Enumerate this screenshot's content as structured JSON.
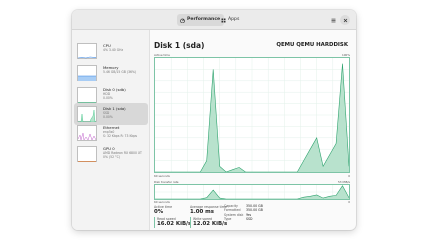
{
  "header": {
    "tabs": [
      {
        "label": "Performance",
        "icon": "performance-icon",
        "active": true
      },
      {
        "label": "Apps",
        "icon": "apps-icon",
        "active": false
      }
    ]
  },
  "sidebar": {
    "items": [
      {
        "title": "CPU",
        "sub1": "4% 3.40 GHz",
        "sub2": "",
        "color": "#3584e4",
        "selected": false
      },
      {
        "title": "Memory",
        "sub1": "5.46 GB/15 GB (36%)",
        "sub2": "",
        "color": "#3584e4",
        "selected": false
      },
      {
        "title": "Disk 0 (sdb)",
        "sub1": "HDD",
        "sub2": "0.00%",
        "color": "#2ec27e",
        "selected": false
      },
      {
        "title": "Disk 1 (sda)",
        "sub1": "SSD",
        "sub2": "0.00%",
        "color": "#2ec27e",
        "selected": true
      },
      {
        "title": "Ethernet",
        "sub1": "enp5s0",
        "sub2": "S: 32 Kbps R: 73 Kbps",
        "color": "#c061cb",
        "selected": false
      },
      {
        "title": "GPU 0",
        "sub1": "AMD Radeon RX 6800 XT",
        "sub2": "0% (52 °C)",
        "color": "#e66100",
        "selected": false
      }
    ]
  },
  "main": {
    "title": "Disk 1 (sda)",
    "device": "QEMU QEMU HARDDISK",
    "active_time_label": "Active time",
    "max_label": "100%",
    "sixty_label": "60 seconds",
    "zero_label": "0",
    "transfer_label": "Disk transfer rate",
    "transfer_max": "53 MiB/s",
    "transfer_sixty": "60 seconds",
    "transfer_zero": "0"
  },
  "stats": {
    "active_time": {
      "label": "Active time",
      "value": "0%"
    },
    "response": {
      "label": "Average response time",
      "value": "1.00 ms"
    },
    "read": {
      "label": "Read speed",
      "value": "16.02 KiB/s"
    },
    "write": {
      "label": "Write speed",
      "value": "12.02 KiB/s"
    }
  },
  "info": [
    {
      "k": "Capacity",
      "v": "350.00 GB"
    },
    {
      "k": "Formatted",
      "v": "350.00 GB"
    },
    {
      "k": "System disk",
      "v": "Yes"
    },
    {
      "k": "Type",
      "v": "SSD"
    }
  ],
  "chart_data": [
    {
      "type": "area",
      "title": "Active time",
      "ylim": [
        0,
        100
      ],
      "x": [
        60,
        58,
        56,
        54,
        52,
        50,
        48,
        46,
        44,
        42,
        40,
        38,
        36,
        34,
        32,
        30,
        28,
        26,
        24,
        22,
        20,
        18,
        16,
        14,
        12,
        10,
        8,
        6,
        4,
        2,
        0
      ],
      "values": [
        0,
        0,
        0,
        0,
        0,
        0,
        0,
        0,
        10,
        90,
        5,
        0,
        2,
        4,
        0,
        0,
        0,
        0,
        0,
        0,
        0,
        0,
        0,
        10,
        20,
        30,
        5,
        15,
        25,
        95,
        5
      ]
    },
    {
      "type": "area",
      "title": "Disk transfer rate",
      "x": [
        60,
        58,
        56,
        54,
        52,
        50,
        48,
        46,
        44,
        42,
        40,
        38,
        36,
        34,
        32,
        30,
        28,
        26,
        24,
        22,
        20,
        18,
        16,
        14,
        12,
        10,
        8,
        6,
        4,
        2,
        0
      ],
      "values": [
        0,
        0,
        0,
        0,
        0,
        0,
        0,
        0,
        3,
        20,
        2,
        0,
        0,
        0,
        0,
        0,
        0,
        0,
        0,
        0,
        0,
        0,
        0,
        4,
        6,
        9,
        2,
        6,
        8,
        30,
        3
      ]
    }
  ]
}
